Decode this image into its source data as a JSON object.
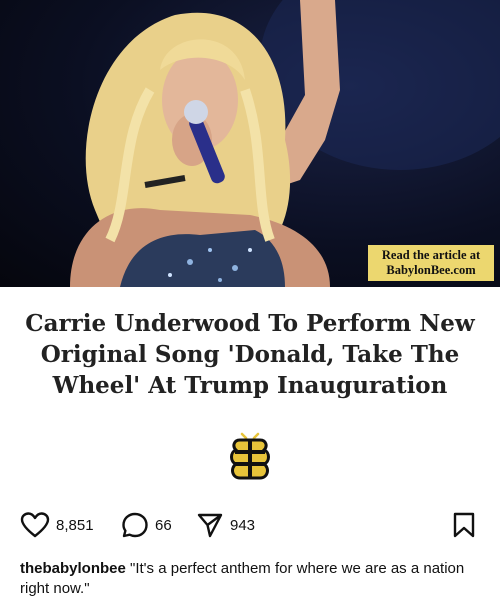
{
  "photo": {
    "alt_icon": "singer-photo",
    "badge": {
      "line1": "Read the article at",
      "line2": "BabylonBee.com"
    },
    "badge_color": "#ecd76f"
  },
  "headline": {
    "lines": [
      "Carrie Underwood To Perform New",
      "Original Song 'Donald, Take The",
      "Wheel' At Trump Inauguration"
    ]
  },
  "logo_icon": "babylon-bee-logo-icon",
  "actions": {
    "likes": "8,851",
    "comments": "66",
    "shares": "943",
    "icons": [
      "heart-icon",
      "comment-icon",
      "share-icon",
      "bookmark-icon"
    ]
  },
  "caption": {
    "username": "thebabylonbee",
    "text": " \"It's a perfect anthem for where we are as a nation right now.\""
  }
}
